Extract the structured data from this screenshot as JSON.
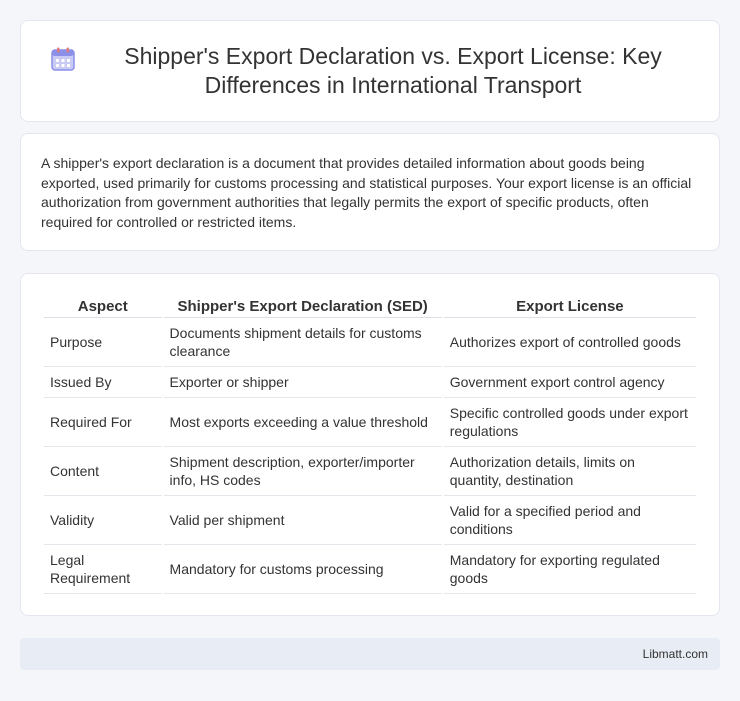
{
  "header": {
    "title": "Shipper's Export Declaration vs. Export License: Key Differences in International Transport",
    "icon": "calendar-icon",
    "icon_color": "#8b8fe8"
  },
  "intro": {
    "text": "A shipper's export declaration is a document that provides detailed information about goods being exported, used primarily for customs processing and statistical purposes. Your export license is an official authorization from government authorities that legally permits the export of specific products, often required for controlled or restricted items."
  },
  "table": {
    "headers": [
      "Aspect",
      "Shipper's Export Declaration (SED)",
      "Export License"
    ],
    "rows": [
      [
        "Purpose",
        "Documents shipment details for customs clearance",
        "Authorizes export of controlled goods"
      ],
      [
        "Issued By",
        "Exporter or shipper",
        "Government export control agency"
      ],
      [
        "Required For",
        "Most exports exceeding a value threshold",
        "Specific controlled goods under export regulations"
      ],
      [
        "Content",
        "Shipment description, exporter/importer info, HS codes",
        "Authorization details, limits on quantity, destination"
      ],
      [
        "Validity",
        "Valid per shipment",
        "Valid for a specified period and conditions"
      ],
      [
        "Legal Requirement",
        "Mandatory for customs processing",
        "Mandatory for exporting regulated goods"
      ]
    ]
  },
  "footer": {
    "text": "Libmatt.com"
  }
}
